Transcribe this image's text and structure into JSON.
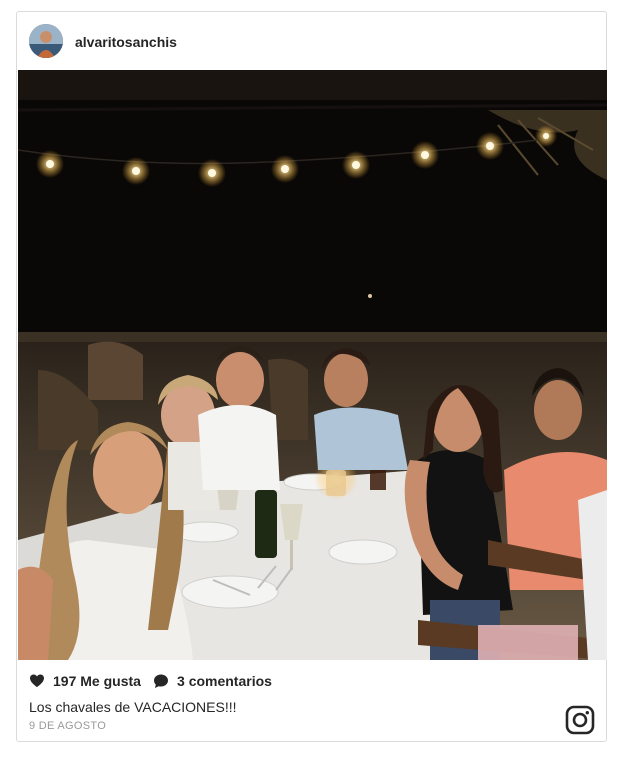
{
  "post": {
    "username": "alvaritosanchis",
    "likes_count": "197",
    "likes_label": "Me gusta",
    "comments_count": "3",
    "comments_label": "comentarios",
    "caption": "Los chavales de VACACIONES!!!",
    "date": "9 DE AGOSTO"
  },
  "icons": {
    "avatar": "avatar-photo",
    "like": "heart-icon",
    "comment": "comment-bubble-icon",
    "brand": "instagram-icon"
  },
  "colors": {
    "text": "#262626",
    "muted": "#999999",
    "border": "#dbdbdb"
  }
}
